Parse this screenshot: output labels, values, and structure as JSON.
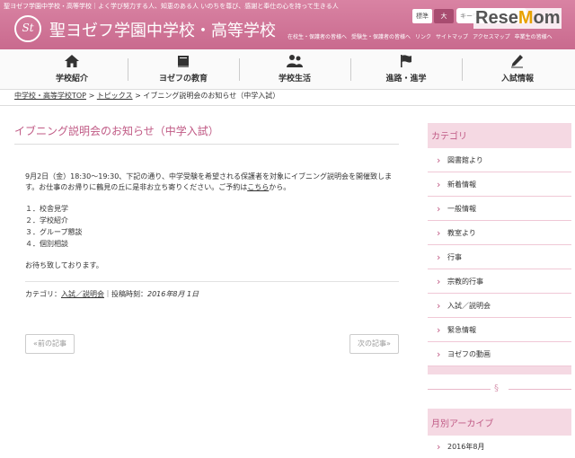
{
  "header": {
    "tagline": "聖ヨゼフ学園中学校・高等学校｜よく学び努力する人、知恵のある人 いのちを尊び、感謝と奉仕の心を持って生きる人",
    "logo_text": "St",
    "school_name": "聖ヨゼフ学園中学校・高等学校",
    "size_standard": "標準",
    "size_large": "大",
    "search_placeholder": "キーワード",
    "brand": "ReseMom",
    "top_links": [
      "在校生・保護者の皆様へ",
      "受験生・保護者の皆様へ",
      "リンク",
      "サイトマップ",
      "アクセスマップ",
      "卒業生の皆様へ"
    ]
  },
  "nav": [
    {
      "label": "学校紹介",
      "icon": "home-icon"
    },
    {
      "label": "ヨゼフの教育",
      "icon": "book-icon"
    },
    {
      "label": "学校生活",
      "icon": "people-icon"
    },
    {
      "label": "進路・進学",
      "icon": "flag-icon"
    },
    {
      "label": "入試情報",
      "icon": "pencil-icon"
    }
  ],
  "breadcrumb": {
    "home": "中学校・高等学校TOP",
    "topics": "トピックス",
    "current": "イブニング説明会のお知らせ（中学入試）",
    "sep": ">"
  },
  "article": {
    "title": "イブニング説明会のお知らせ（中学入試）",
    "body_before_link": "9月2日（金）18:30～19:30、下記の通り、中学受験を希望される保護者を対象にイブニング説明会を開催致します。お仕事のお帰りに鶴見の丘に是非お立ち寄りください。ご予約は",
    "body_link": "こちら",
    "body_after_link": "から。",
    "list": [
      "１．校舎見学",
      "２．学校紹介",
      "３．グループ懇談",
      "４．個別相談"
    ],
    "closing": "お待ち致しております。",
    "category_label": "カテゴリ：",
    "category": "入試／説明会",
    "posted_label": "｜投稿時刻：",
    "posted": "2016年8月 1日",
    "prev": "«前の記事",
    "next": "次の記事»"
  },
  "sidebar": {
    "category_heading": "カテゴリ",
    "categories": [
      "図書館より",
      "新着情報",
      "一般情報",
      "教室より",
      "行事",
      "宗教的行事",
      "入試／説明会",
      "緊急情報",
      "ヨゼフの動画"
    ],
    "separator": "§",
    "archive_heading": "月別アーカイブ",
    "archive": [
      "2016年8月"
    ]
  },
  "colors": {
    "brand_pink": "#c96a8e",
    "accent_text": "#c05a85",
    "sidebar_bg": "#f5d9e3"
  }
}
